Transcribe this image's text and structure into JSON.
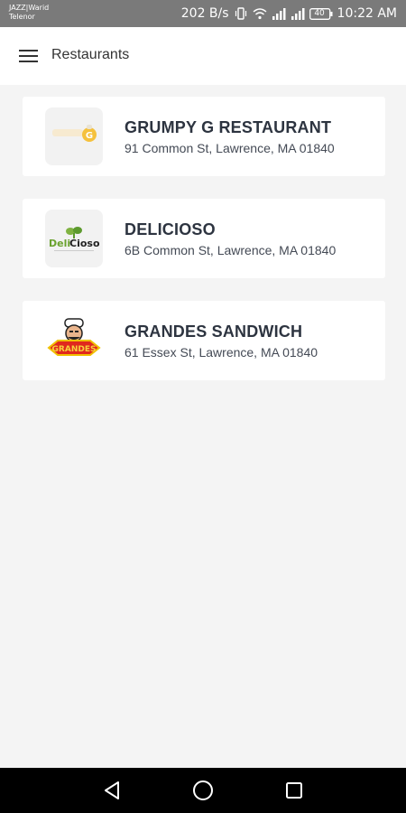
{
  "status_bar": {
    "carrier_line1": "JAZZ|Warid",
    "carrier_line2": "Telenor",
    "speed": "202 B/s",
    "battery": "40",
    "time": "10:22 AM"
  },
  "app_bar": {
    "title": "Restaurants",
    "menu_icon": "hamburger-menu-icon"
  },
  "restaurants": [
    {
      "name": "GRUMPY G RESTAURANT",
      "address": "91 Common St, Lawrence, MA 01840",
      "logo_letter": "G"
    },
    {
      "name": "DELICIOSO",
      "address": "6B Common St, Lawrence, MA 01840",
      "logo_text_a": "Deli",
      "logo_text_b": "Cioso"
    },
    {
      "name": "GRANDES SANDWICH",
      "address": "61 Essex St, Lawrence, MA 01840",
      "logo_text": "GRANDES"
    }
  ],
  "colors": {
    "status_bar_bg": "#7a7a7a",
    "background": "#f4f4f4",
    "card_bg": "#ffffff",
    "name_text": "#2d3440",
    "nav_bar_bg": "#000000"
  }
}
